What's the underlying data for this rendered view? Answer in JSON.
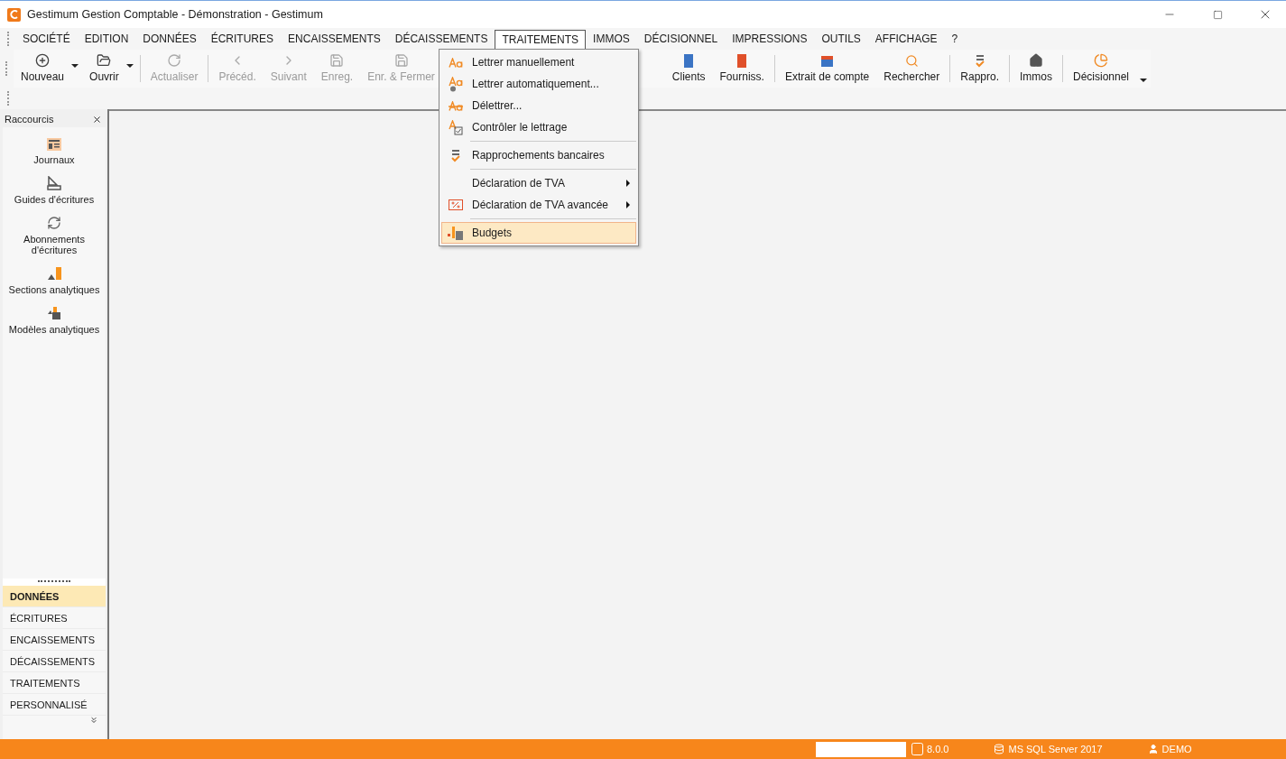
{
  "window": {
    "title": "Gestimum Gestion Comptable - Démonstration - Gestimum"
  },
  "menubar": [
    {
      "label": "SOCIÉTÉ",
      "selected": false
    },
    {
      "label": "EDITION",
      "selected": false
    },
    {
      "label": "DONNÉES",
      "selected": false
    },
    {
      "label": "ÉCRITURES",
      "selected": false
    },
    {
      "label": "ENCAISSEMENTS",
      "selected": false
    },
    {
      "label": "DÉCAISSEMENTS",
      "selected": false
    },
    {
      "label": "TRAITEMENTS",
      "selected": true
    },
    {
      "label": "IMMOS",
      "selected": false
    },
    {
      "label": "DÉCISIONNEL",
      "selected": false
    },
    {
      "label": "IMPRESSIONS",
      "selected": false
    },
    {
      "label": "OUTILS",
      "selected": false
    },
    {
      "label": "AFFICHAGE",
      "selected": false
    },
    {
      "label": "?",
      "selected": false
    }
  ],
  "toolbar_left": [
    {
      "label": "Nouveau",
      "disabled": false,
      "dropdown": true
    },
    {
      "label": "Ouvrir",
      "disabled": false,
      "dropdown": true
    },
    {
      "label": "Actualiser",
      "disabled": true,
      "dropdown": false
    },
    {
      "label": "Précéd.",
      "disabled": true,
      "dropdown": false
    },
    {
      "label": "Suivant",
      "disabled": true,
      "dropdown": false
    },
    {
      "label": "Enreg.",
      "disabled": true,
      "dropdown": false
    },
    {
      "label": "Enr. & Fermer",
      "disabled": true,
      "dropdown": false
    }
  ],
  "toolbar_right": [
    {
      "label": "Clients",
      "group_start": false
    },
    {
      "label": "Fourniss.",
      "group_start": false
    },
    {
      "label": "Extrait de compte",
      "group_start": true
    },
    {
      "label": "Rechercher",
      "group_start": false
    },
    {
      "label": "Rappro.",
      "group_start": true
    },
    {
      "label": "Immos",
      "group_start": true
    },
    {
      "label": "Décisionnel",
      "group_start": true
    }
  ],
  "dropdown_menu": [
    {
      "label": "Lettrer manuellement",
      "selected": false,
      "submenu": false,
      "group_start": false
    },
    {
      "label": "Lettrer automatiquement...",
      "selected": false,
      "submenu": false,
      "group_start": false
    },
    {
      "label": "Délettrer...",
      "selected": false,
      "submenu": false,
      "group_start": false
    },
    {
      "label": "Contrôler le lettrage",
      "selected": false,
      "submenu": false,
      "group_start": false
    },
    {
      "label": "Rapprochements bancaires",
      "selected": false,
      "submenu": false,
      "group_start": true
    },
    {
      "label": "Déclaration de TVA",
      "selected": false,
      "submenu": true,
      "group_start": true
    },
    {
      "label": "Déclaration de TVA avancée",
      "selected": false,
      "submenu": true,
      "group_start": false
    },
    {
      "label": "Budgets",
      "selected": true,
      "submenu": false,
      "group_start": true
    }
  ],
  "sidebar": {
    "title": "Raccourcis",
    "shortcuts": [
      "Journaux",
      "Guides d'écritures",
      "Abonnements d'écritures",
      "Sections analytiques",
      "Modèles analytiques"
    ],
    "sections": [
      {
        "label": "DONNÉES",
        "selected": true
      },
      {
        "label": "ÉCRITURES",
        "selected": false
      },
      {
        "label": "ENCAISSEMENTS",
        "selected": false
      },
      {
        "label": "DÉCAISSEMENTS",
        "selected": false
      },
      {
        "label": "TRAITEMENTS",
        "selected": false
      },
      {
        "label": "PERSONNALISÉ",
        "selected": false
      }
    ]
  },
  "status_bar": {
    "version": "8.0.0",
    "database": "MS SQL Server 2017",
    "user": "DEMO"
  }
}
